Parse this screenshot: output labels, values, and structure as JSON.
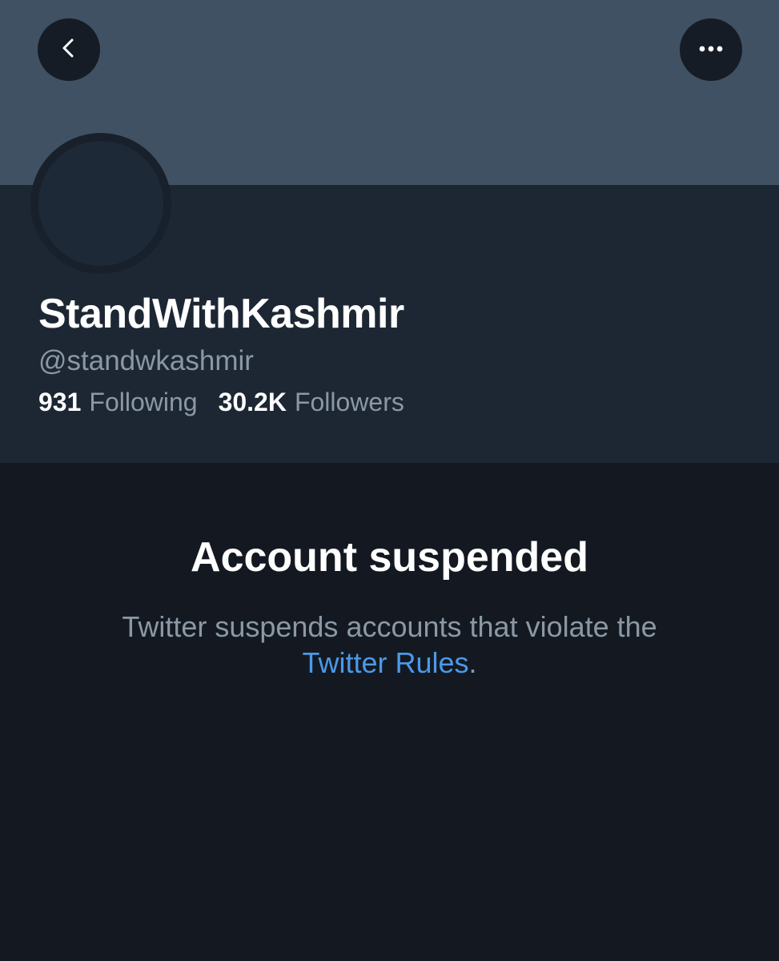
{
  "profile": {
    "display_name": "StandWithKashmir",
    "handle": "@standwkashmir",
    "following_count": "931",
    "following_label": "Following",
    "followers_count": "30.2K",
    "followers_label": "Followers"
  },
  "suspension": {
    "title": "Account suspended",
    "message_line1": "Twitter suspends accounts that violate the",
    "link_text": "Twitter Rules",
    "message_end": "."
  },
  "icons": {
    "back": "chevron-left-icon",
    "more": "more-horizontal-icon"
  },
  "colors": {
    "banner": "#405163",
    "header_panel": "#1d2734",
    "page_background": "#141921",
    "link": "#4a99e9",
    "secondary_text": "#8b98a5"
  }
}
